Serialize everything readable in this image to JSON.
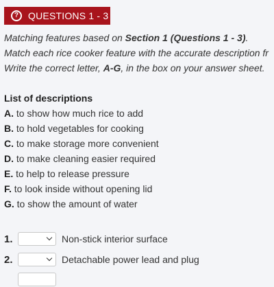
{
  "header": {
    "badge": "QUESTIONS 1 - 3",
    "icon": "question-circle-icon",
    "color": "#a8141c"
  },
  "instructions": {
    "line1_prefix": "Matching features based on ",
    "line1_bold": "Section 1 (Questions 1 - 3)",
    "line1_suffix": ".",
    "line2": "Match each rice cooker feature with the accurate description fr",
    "line3_prefix": "Write the correct letter, ",
    "line3_bold": "A-G",
    "line3_suffix": ", in the box on your answer sheet."
  },
  "list": {
    "title": "List of descriptions",
    "items": [
      {
        "letter": "A.",
        "text": " to show how much rice to add"
      },
      {
        "letter": "B.",
        "text": " to hold vegetables for cooking"
      },
      {
        "letter": "C.",
        "text": " to make storage more convenient"
      },
      {
        "letter": "D.",
        "text": " to make cleaning easier required"
      },
      {
        "letter": "E.",
        "text": " to help to release pressure"
      },
      {
        "letter": "F.",
        "text": " to look inside without opening lid"
      },
      {
        "letter": "G.",
        "text": " to show the amount of water"
      }
    ]
  },
  "questions": [
    {
      "num": "1.",
      "selected": "",
      "label": "Non-stick interior surface"
    },
    {
      "num": "2.",
      "selected": "",
      "label": "Detachable power lead and plug"
    }
  ]
}
